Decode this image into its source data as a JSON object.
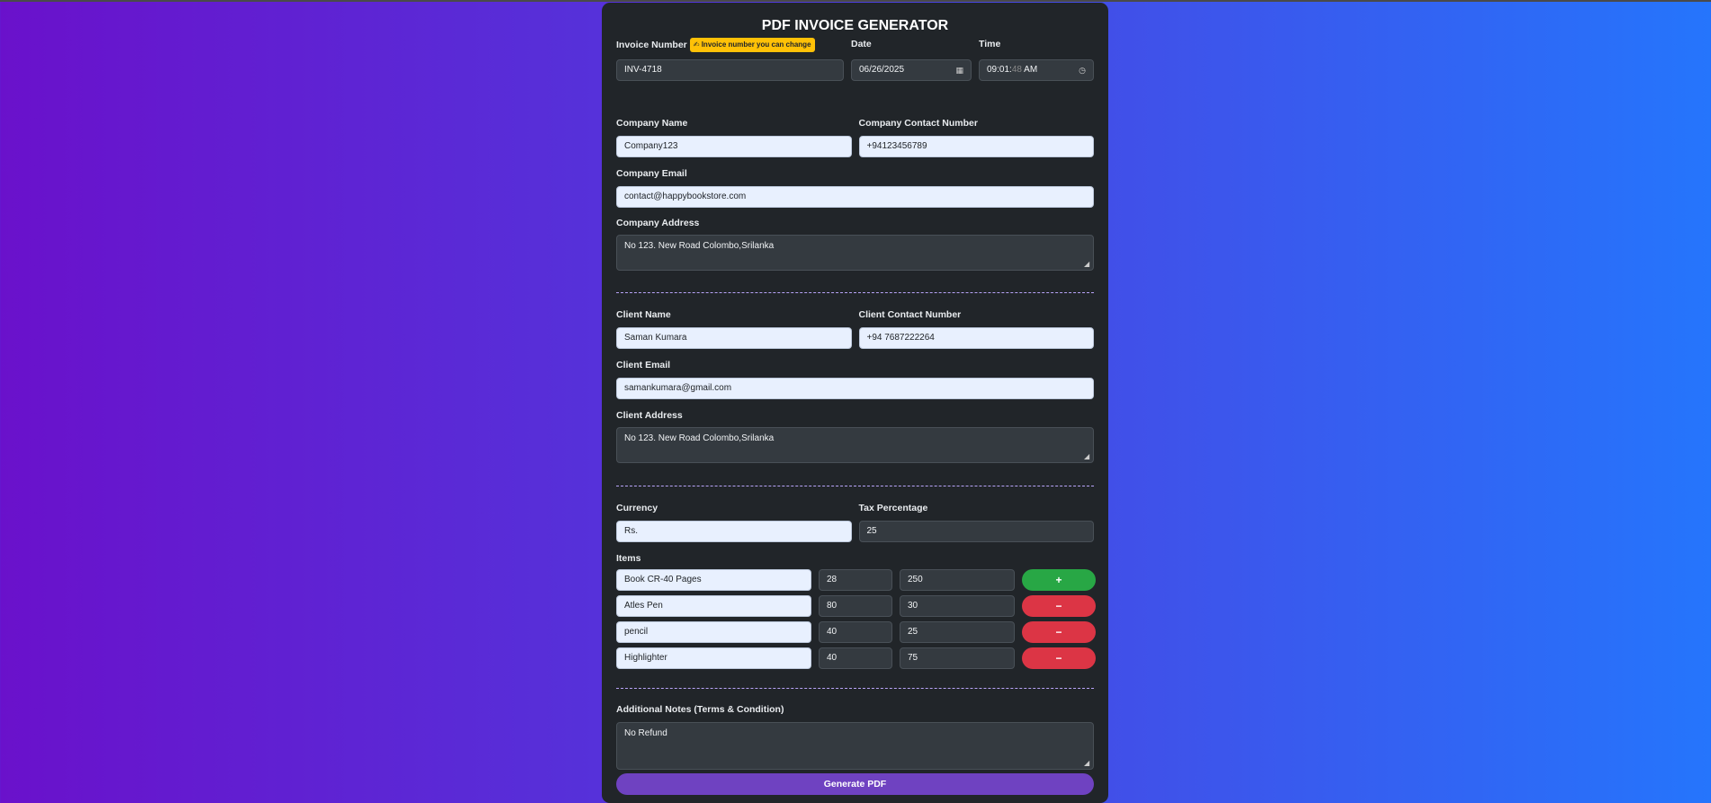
{
  "title": "PDF INVOICE GENERATOR",
  "invoice": {
    "number_label": "Invoice Number",
    "badge": "✍ Invoice number you can change",
    "number_value": "INV-4718",
    "date_label": "Date",
    "date_value": "06/26/2025",
    "time_label": "Time",
    "time_value_hm": "09:01:",
    "time_value_s": "48",
    "time_value_ampm": "AM"
  },
  "company": {
    "name_label": "Company Name",
    "name_value": "Company123",
    "contact_label": "Company Contact Number",
    "contact_value": "+94123456789",
    "email_label": "Company Email",
    "email_value": "contact@happybookstore.com",
    "address_label": "Company Address",
    "address_value": "No 123. New Road Colombo,Srilanka"
  },
  "client": {
    "name_label": "Client Name",
    "name_value": "Saman Kumara",
    "contact_label": "Client Contact Number",
    "contact_value": "+94 7687222264",
    "email_label": "Client Email",
    "email_value": "samankumara@gmail.com",
    "address_label": "Client Address",
    "address_value": "No 123. New Road Colombo,Srilanka"
  },
  "billing": {
    "currency_label": "Currency",
    "currency_value": "Rs.",
    "tax_label": "Tax Percentage",
    "tax_value": "25",
    "items_label": "Items",
    "items": [
      {
        "name": "Book CR-40 Pages",
        "qty": "28",
        "price": "250",
        "action": "+"
      },
      {
        "name": "Atles Pen",
        "qty": "80",
        "price": "30",
        "action": "−"
      },
      {
        "name": "pencil",
        "qty": "40",
        "price": "25",
        "action": "−"
      },
      {
        "name": "Highlighter",
        "qty": "40",
        "price": "75",
        "action": "−"
      }
    ]
  },
  "notes": {
    "label": "Additional Notes (Terms & Condition)",
    "value": "No Refund"
  },
  "generate_label": "Generate PDF",
  "colors": {
    "accent": "#6f42c1",
    "add": "#28a745",
    "remove": "#dc3545",
    "badge": "#ffc107"
  }
}
